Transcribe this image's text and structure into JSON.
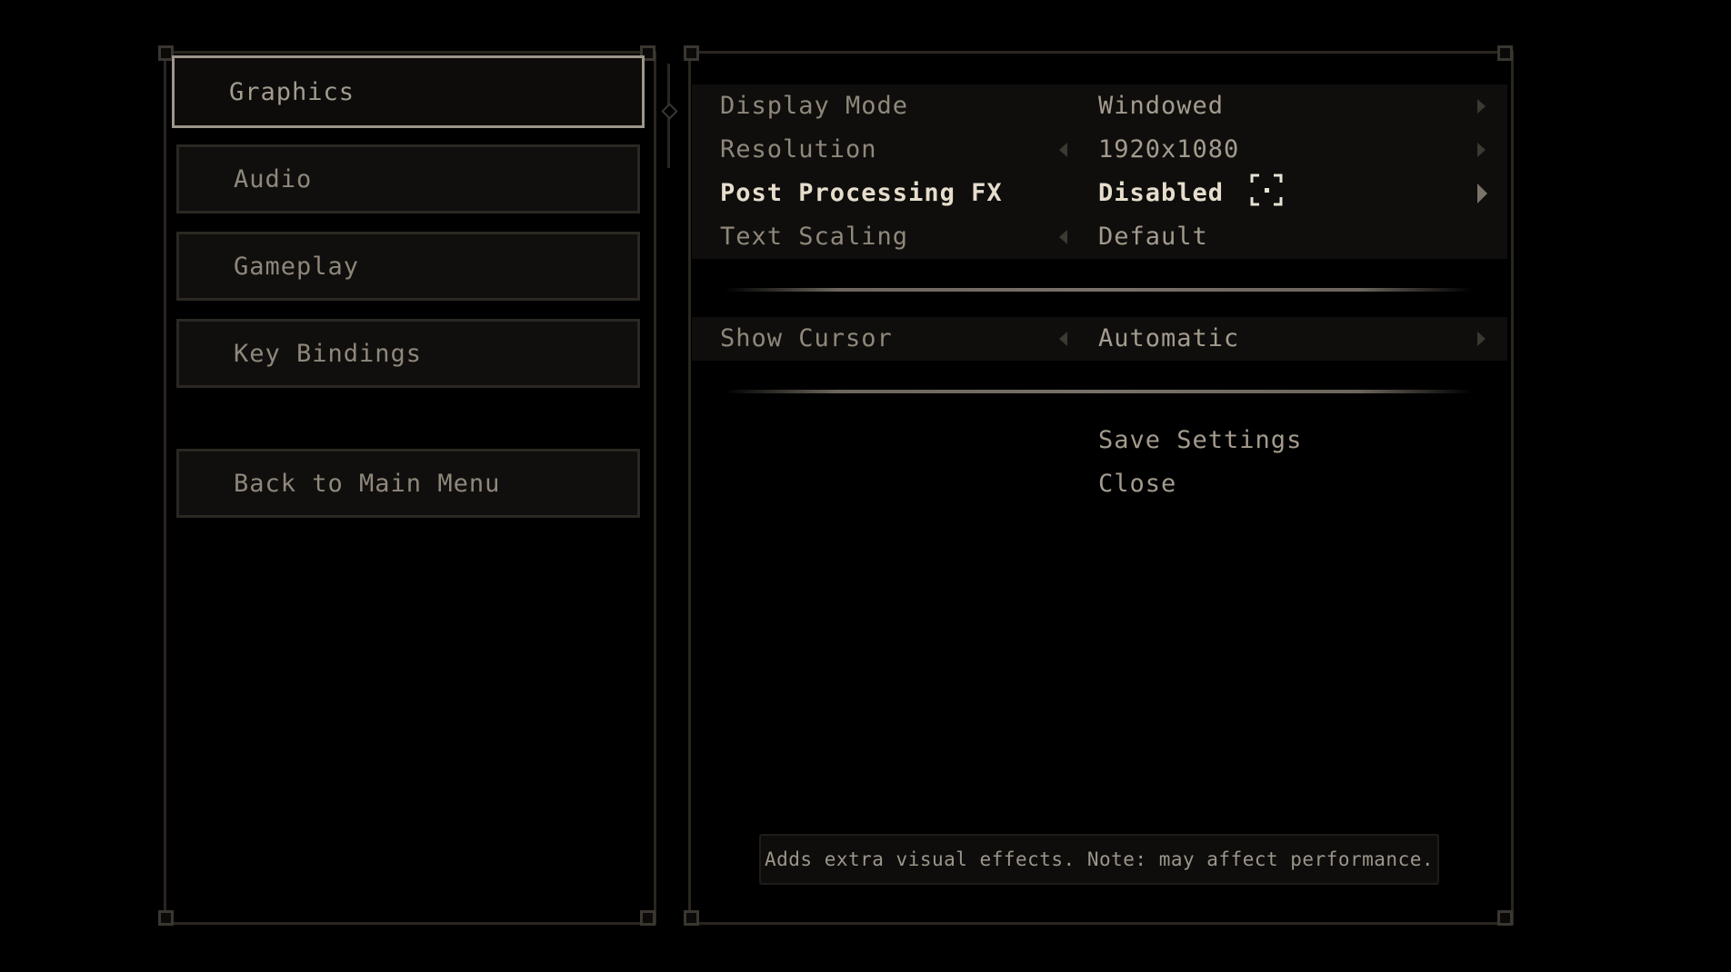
{
  "nav": {
    "items": [
      {
        "label": "Graphics",
        "active": true
      },
      {
        "label": "Audio",
        "active": false
      },
      {
        "label": "Gameplay",
        "active": false
      },
      {
        "label": "Key Bindings",
        "active": false
      }
    ],
    "back_label": "Back to Main Menu"
  },
  "settings": {
    "rows": [
      {
        "label": "Display Mode",
        "value": "Windowed",
        "selected": false,
        "has_left_arrow": false,
        "has_right_arrow": true
      },
      {
        "label": "Resolution",
        "value": "1920x1080",
        "selected": false,
        "has_left_arrow": true,
        "has_right_arrow": true
      },
      {
        "label": "Post Processing FX",
        "value": "Disabled",
        "selected": true,
        "has_left_arrow": false,
        "has_right_arrow": true
      },
      {
        "label": "Text Scaling",
        "value": "Default",
        "selected": false,
        "has_left_arrow": true,
        "has_right_arrow": false
      }
    ],
    "cursor_row": {
      "label": "Show Cursor",
      "value": "Automatic",
      "has_left_arrow": true,
      "has_right_arrow": true
    }
  },
  "actions": {
    "save_label": "Save Settings",
    "close_label": "Close"
  },
  "tooltip": {
    "text": "Adds extra visual effects. Note: may affect performance."
  },
  "colors": {
    "background": "#000000",
    "panel_border": "#2a2620",
    "text_default": "#8f877b",
    "text_selected": "#e6ddcc",
    "active_border": "#9c958a"
  },
  "icons": {
    "arrow_left": "chevron-left-icon",
    "arrow_right": "chevron-right-icon",
    "cursor": "crosshair-reticle-icon"
  }
}
